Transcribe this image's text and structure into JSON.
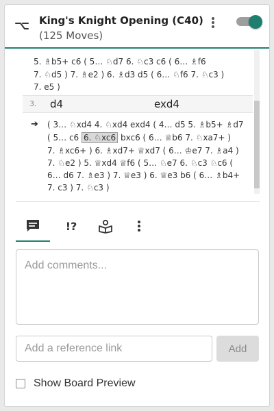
{
  "header": {
    "title_main": "King's Knight Opening (C40)",
    "title_count": "(125 Moves)",
    "toggle_on": true,
    "accent_color": "#1e7f6e",
    "icons": {
      "branch": "branch-icon",
      "menu": "more-vertical-icon"
    }
  },
  "moves": {
    "variation_top_line1": "5. ♗b5+   c6  ( 5… ♘d7   6. ♘c3   c6  ( 6… ♗f6",
    "variation_top_line2": "7. ♘d5 )   7. ♗e2 )   6. ♗d3   d5  ( 6… ♘f6   7. ♘c3 )",
    "variation_top_line3": "7. e5 )",
    "main_row": {
      "number": "3.",
      "white": "d4",
      "black": "exd4"
    },
    "arrow": "➔",
    "var_line1_pre": "( 3… ♘xd4   4. ♘xd4   exd4  ( 4… d5   5. ♗b5+   ♗d7",
    "var_line2_pre": "( 5… c6",
    "var_line2_selected": "6. ♘xc6",
    "var_line2_post": "bxc6  ( 6… ♕b6   7. ♘xa7+ )",
    "var_line3": "7. ♗xc6+ )   6. ♗xd7+   ♕xd7  ( 6… ♔e7   7. ♗a4 )",
    "var_line4": "7. ♘e2 )   5. ♕xd4   ♕f6  ( 5… ♘e7   6. ♘c3   ♘c6  (",
    "var_line5": "6… d6   7. ♗e3 )   7. ♕e3 )   6. ♕e3   b6  ( 6… ♗b4+",
    "var_line6": "7. c3 )   7. ♘c3 )"
  },
  "tabs": [
    {
      "name": "comments",
      "icon": "comment-icon"
    },
    {
      "name": "annotations",
      "label": "!?"
    },
    {
      "name": "library",
      "icon": "book-icon"
    },
    {
      "name": "more",
      "icon": "more-vertical-icon"
    }
  ],
  "comments": {
    "placeholder": "Add comments..."
  },
  "reference": {
    "placeholder": "Add a reference link",
    "add_label": "Add"
  },
  "preview": {
    "label": "Show Board Preview",
    "checked": false
  }
}
